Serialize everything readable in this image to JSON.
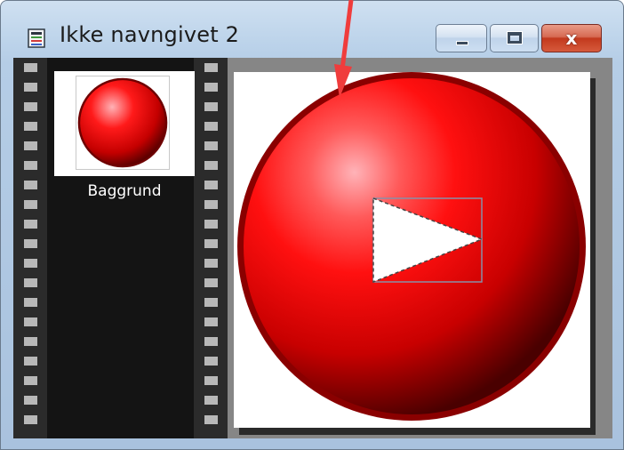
{
  "window": {
    "title": "Ikke navngivet 2",
    "icon": "document-icon",
    "controls": {
      "minimize": "minimize-icon",
      "maximize": "maximize-icon",
      "close_glyph": "x"
    }
  },
  "filmstrip": {
    "items": [
      {
        "label": "Baggrund",
        "thumbnail": "red-sphere"
      }
    ]
  },
  "colors": {
    "sphere_main": "#ff1010",
    "sphere_highlight": "#ff9aa2",
    "sphere_rim": "#8a0000",
    "annotation_arrow": "#f03c3c",
    "selection_box": "#8890a8"
  }
}
